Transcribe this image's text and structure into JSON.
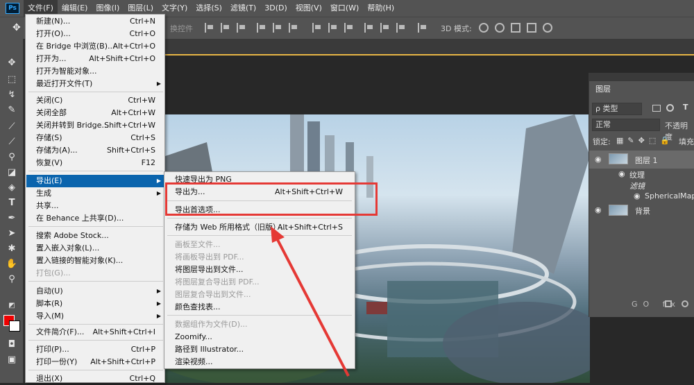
{
  "app": {
    "logo": "Ps"
  },
  "menubar": {
    "items": [
      "文件(F)",
      "编辑(E)",
      "图像(I)",
      "图层(L)",
      "文字(Y)",
      "选择(S)",
      "滤镜(T)",
      "3D(D)",
      "视图(V)",
      "窗口(W)",
      "帮助(H)"
    ]
  },
  "options_bar": {
    "partial_text": "换控件",
    "mode_3d_label": "3D 模式:"
  },
  "file_menu": {
    "items": [
      {
        "label": "新建(N)...",
        "shortcut": "Ctrl+N"
      },
      {
        "label": "打开(O)...",
        "shortcut": "Ctrl+O"
      },
      {
        "label": "在 Bridge 中浏览(B)...",
        "shortcut": "Alt+Ctrl+O"
      },
      {
        "label": "打开为...",
        "shortcut": "Alt+Shift+Ctrl+O"
      },
      {
        "label": "打开为智能对象...",
        "shortcut": ""
      },
      {
        "label": "最近打开文件(T)",
        "shortcut": ""
      },
      {
        "label": "关闭(C)",
        "shortcut": "Ctrl+W"
      },
      {
        "label": "关闭全部",
        "shortcut": "Alt+Ctrl+W"
      },
      {
        "label": "关闭并转到 Bridge...",
        "shortcut": "Shift+Ctrl+W"
      },
      {
        "label": "存储(S)",
        "shortcut": "Ctrl+S"
      },
      {
        "label": "存储为(A)...",
        "shortcut": "Shift+Ctrl+S"
      },
      {
        "label": "恢复(V)",
        "shortcut": "F12"
      },
      {
        "label": "导出(E)",
        "shortcut": ""
      },
      {
        "label": "生成",
        "shortcut": ""
      },
      {
        "label": "共享...",
        "shortcut": ""
      },
      {
        "label": "在 Behance 上共享(D)...",
        "shortcut": ""
      },
      {
        "label": "搜索 Adobe Stock...",
        "shortcut": ""
      },
      {
        "label": "置入嵌入对象(L)...",
        "shortcut": ""
      },
      {
        "label": "置入链接的智能对象(K)...",
        "shortcut": ""
      },
      {
        "label": "打包(G)...",
        "shortcut": ""
      },
      {
        "label": "自动(U)",
        "shortcut": ""
      },
      {
        "label": "脚本(R)",
        "shortcut": ""
      },
      {
        "label": "导入(M)",
        "shortcut": ""
      },
      {
        "label": "文件简介(F)...",
        "shortcut": "Alt+Shift+Ctrl+I"
      },
      {
        "label": "打印(P)...",
        "shortcut": "Ctrl+P"
      },
      {
        "label": "打印一份(Y)",
        "shortcut": "Alt+Shift+Ctrl+P"
      },
      {
        "label": "退出(X)",
        "shortcut": "Ctrl+Q"
      }
    ]
  },
  "export_menu": {
    "items": [
      {
        "label": "快速导出为 PNG",
        "shortcut": ""
      },
      {
        "label": "导出为...",
        "shortcut": "Alt+Shift+Ctrl+W"
      },
      {
        "label": "导出首选项...",
        "shortcut": ""
      },
      {
        "label": "存储为 Web 所用格式（旧版）...",
        "shortcut": "Alt+Shift+Ctrl+S"
      },
      {
        "label": "画板至文件...",
        "shortcut": ""
      },
      {
        "label": "将画板导出到 PDF...",
        "shortcut": ""
      },
      {
        "label": "将图层导出到文件...",
        "shortcut": ""
      },
      {
        "label": "将图层复合导出到 PDF...",
        "shortcut": ""
      },
      {
        "label": "图层复合导出到文件...",
        "shortcut": ""
      },
      {
        "label": "颜色查找表...",
        "shortcut": ""
      },
      {
        "label": "数据组作为文件(D)...",
        "shortcut": ""
      },
      {
        "label": "Zoomify...",
        "shortcut": ""
      },
      {
        "label": "路径到 Illustrator...",
        "shortcut": ""
      },
      {
        "label": "渲染视频...",
        "shortcut": ""
      }
    ]
  },
  "layers_panel": {
    "tab": "图层",
    "filter": "ρ 类型",
    "blend_mode": "正常",
    "opacity_label": "不透明度",
    "lock_label": "锁定:",
    "fill_label": "填充",
    "layers": [
      {
        "name": "图层 1"
      },
      {
        "name": "纹理"
      },
      {
        "name": "滤镜"
      },
      {
        "name": "SphericalMap"
      },
      {
        "name": "背景"
      }
    ],
    "footer_icons": "GO fx"
  },
  "colors": {
    "foreground": "#e00000",
    "background": "#ffffff",
    "annotation": "#e53935",
    "menu_highlight": "#0a64ad"
  }
}
